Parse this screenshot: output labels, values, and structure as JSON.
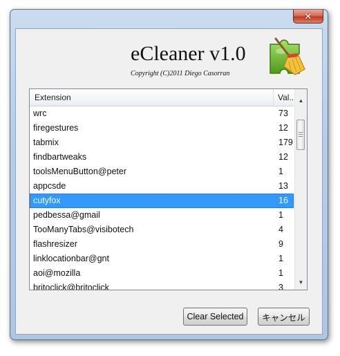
{
  "window": {
    "close_glyph": "✕"
  },
  "header": {
    "title": "eCleaner v1.0",
    "copyright": "Copyright (C)2011 Diego Casorran",
    "logo_icon": "broom-puzzle-icon"
  },
  "table": {
    "columns": [
      {
        "label": "Extension"
      },
      {
        "label": "Val..."
      }
    ],
    "rows": [
      {
        "name": "wrc",
        "value": "73"
      },
      {
        "name": "firegestures",
        "value": "12"
      },
      {
        "name": "tabmix",
        "value": "179"
      },
      {
        "name": "findbartweaks",
        "value": "12"
      },
      {
        "name": "toolsMenuButton@peter",
        "value": "1"
      },
      {
        "name": "appcsde",
        "value": "13"
      },
      {
        "name": "cutyfox",
        "value": "16",
        "selected": true
      },
      {
        "name": "pedbessa@gmail",
        "value": "1"
      },
      {
        "name": "TooManyTabs@visibotech",
        "value": "4"
      },
      {
        "name": "flashresizer",
        "value": "9"
      },
      {
        "name": "linklocationbar@gnt",
        "value": "1"
      },
      {
        "name": "aoi@mozilla",
        "value": "1"
      },
      {
        "name": "britoclick@britoclick",
        "value": "3"
      }
    ]
  },
  "buttons": {
    "clear_selected": "Clear Selected",
    "cancel": "キャンセル"
  },
  "colors": {
    "selection": "#3399ff",
    "close_button": "#c0391c"
  }
}
